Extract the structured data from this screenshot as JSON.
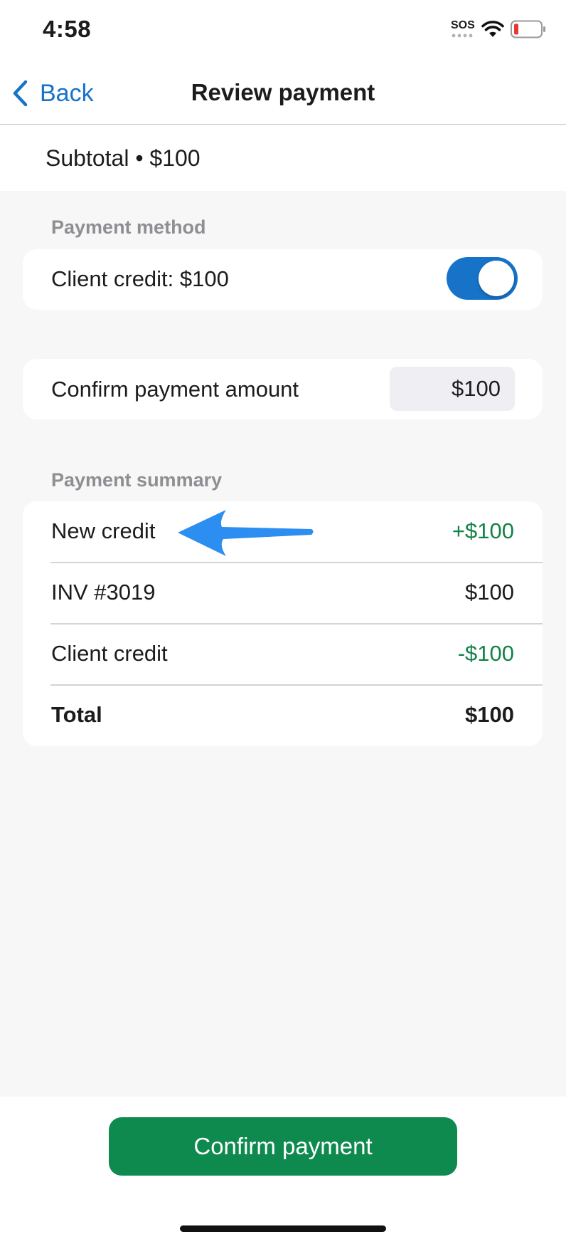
{
  "status_bar": {
    "time": "4:58",
    "sos": "SOS",
    "battery_color": "#e53935"
  },
  "nav": {
    "back_label": "Back",
    "title": "Review payment"
  },
  "subtotal": {
    "text": "Subtotal • $100"
  },
  "payment_method": {
    "section_label": "Payment method",
    "client_credit_label": "Client credit: $100",
    "toggle_on": true
  },
  "confirm_amount": {
    "label": "Confirm payment amount",
    "value": "$100"
  },
  "summary": {
    "section_label": "Payment summary",
    "rows": [
      {
        "label": "New credit",
        "value": "+$100"
      },
      {
        "label": "INV #3019",
        "value": "$100"
      },
      {
        "label": "Client credit",
        "value": "-$100"
      },
      {
        "label": "Total",
        "value": "$100"
      }
    ]
  },
  "annotation": {
    "icon": "blue-arrow-icon",
    "color": "#2b8ef0"
  },
  "footer": {
    "confirm_label": "Confirm payment"
  },
  "colors": {
    "accent": "#1673c8",
    "green": "#138348",
    "button": "#0f8a4f"
  }
}
